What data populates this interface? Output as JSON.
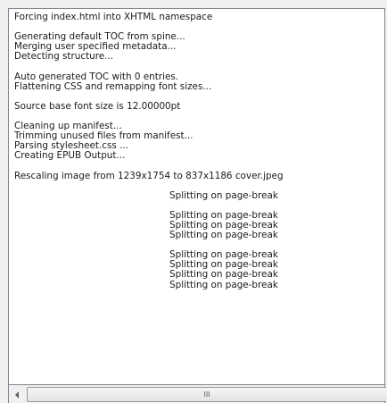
{
  "log": {
    "lines": [
      {
        "text": "Forcing index.html into XHTML namespace",
        "indent": false
      },
      {
        "text": "",
        "indent": false
      },
      {
        "text": "Generating default TOC from spine...",
        "indent": false
      },
      {
        "text": "Merging user specified metadata...",
        "indent": false
      },
      {
        "text": "Detecting structure...",
        "indent": false
      },
      {
        "text": "",
        "indent": false
      },
      {
        "text": "Auto generated TOC with 0 entries.",
        "indent": false
      },
      {
        "text": "Flattening CSS and remapping font sizes...",
        "indent": false
      },
      {
        "text": "",
        "indent": false
      },
      {
        "text": "Source base font size is 12.00000pt",
        "indent": false
      },
      {
        "text": "",
        "indent": false
      },
      {
        "text": "Cleaning up manifest...",
        "indent": false
      },
      {
        "text": "Trimming unused files from manifest...",
        "indent": false
      },
      {
        "text": "Parsing stylesheet.css ...",
        "indent": false
      },
      {
        "text": "Creating EPUB Output...",
        "indent": false
      },
      {
        "text": "",
        "indent": false
      },
      {
        "text": "Rescaling image from 1239x1754 to 837x1186 cover.jpeg",
        "indent": false
      },
      {
        "text": "",
        "indent": false
      },
      {
        "text": "Splitting on page-break",
        "indent": true
      },
      {
        "text": "",
        "indent": false
      },
      {
        "text": "Splitting on page-break",
        "indent": true
      },
      {
        "text": "Splitting on page-break",
        "indent": true
      },
      {
        "text": "Splitting on page-break",
        "indent": true
      },
      {
        "text": "",
        "indent": false
      },
      {
        "text": "Splitting on page-break",
        "indent": true
      },
      {
        "text": "Splitting on page-break",
        "indent": true
      },
      {
        "text": "Splitting on page-break",
        "indent": true
      },
      {
        "text": "Splitting on page-break",
        "indent": true
      }
    ]
  },
  "scrollbar": {
    "left_icon": "arrow-left-icon",
    "grip_icon": "scroll-grip-icon",
    "grip_glyph": "III"
  }
}
